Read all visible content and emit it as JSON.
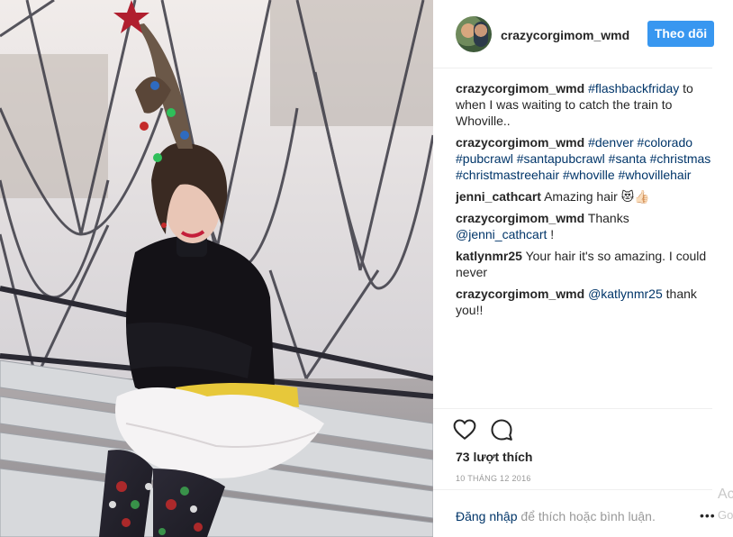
{
  "header": {
    "username": "crazycorgimom_wmd",
    "follow_label": "Theo dõi"
  },
  "comments": [
    {
      "user": "crazycorgimom_wmd",
      "parts": [
        {
          "type": "tag",
          "text": "#flashbackfriday"
        },
        {
          "type": "text",
          "text": " to when I was waiting to catch the train to Whoville.."
        }
      ]
    },
    {
      "user": "crazycorgimom_wmd",
      "parts": [
        {
          "type": "tag",
          "text": "#denver"
        },
        {
          "type": "text",
          "text": " "
        },
        {
          "type": "tag",
          "text": "#colorado"
        },
        {
          "type": "text",
          "text": " "
        },
        {
          "type": "tag",
          "text": "#pubcrawl"
        },
        {
          "type": "text",
          "text": " "
        },
        {
          "type": "tag",
          "text": "#santapubcrawl"
        },
        {
          "type": "text",
          "text": " "
        },
        {
          "type": "tag",
          "text": "#santa"
        },
        {
          "type": "text",
          "text": " "
        },
        {
          "type": "tag",
          "text": "#christmas"
        },
        {
          "type": "text",
          "text": " "
        },
        {
          "type": "tag",
          "text": "#christmastreehair"
        },
        {
          "type": "text",
          "text": " "
        },
        {
          "type": "tag",
          "text": "#whoville"
        },
        {
          "type": "text",
          "text": " "
        },
        {
          "type": "tag",
          "text": "#whovillehair"
        }
      ]
    },
    {
      "user": "jenni_cathcart",
      "parts": [
        {
          "type": "text",
          "text": "Amazing hair 😻👍🏻"
        }
      ]
    },
    {
      "user": "crazycorgimom_wmd",
      "parts": [
        {
          "type": "text",
          "text": "Thanks "
        },
        {
          "type": "mention",
          "text": "@jenni_cathcart"
        },
        {
          "type": "text",
          "text": " !"
        }
      ]
    },
    {
      "user": "katlynmr25",
      "parts": [
        {
          "type": "text",
          "text": "Your hair it's so amazing. I could never"
        }
      ]
    },
    {
      "user": "crazycorgimom_wmd",
      "parts": [
        {
          "type": "mention",
          "text": "@katlynmr25"
        },
        {
          "type": "text",
          "text": " thank you!!"
        }
      ]
    }
  ],
  "actions": {
    "like_icon": "heart-outline-icon",
    "comment_icon": "speech-bubble-icon"
  },
  "likes": "73 lượt thích",
  "date": "10 THÁNG 12 2016",
  "login": {
    "link": "Đăng nhập",
    "rest": " để thích hoặc bình luận.",
    "more": "•••"
  },
  "edge": {
    "ac": "Ac",
    "go": "Go"
  },
  "colors": {
    "accent": "#3897f0",
    "link": "#003569",
    "muted": "#999999",
    "text": "#262626"
  }
}
